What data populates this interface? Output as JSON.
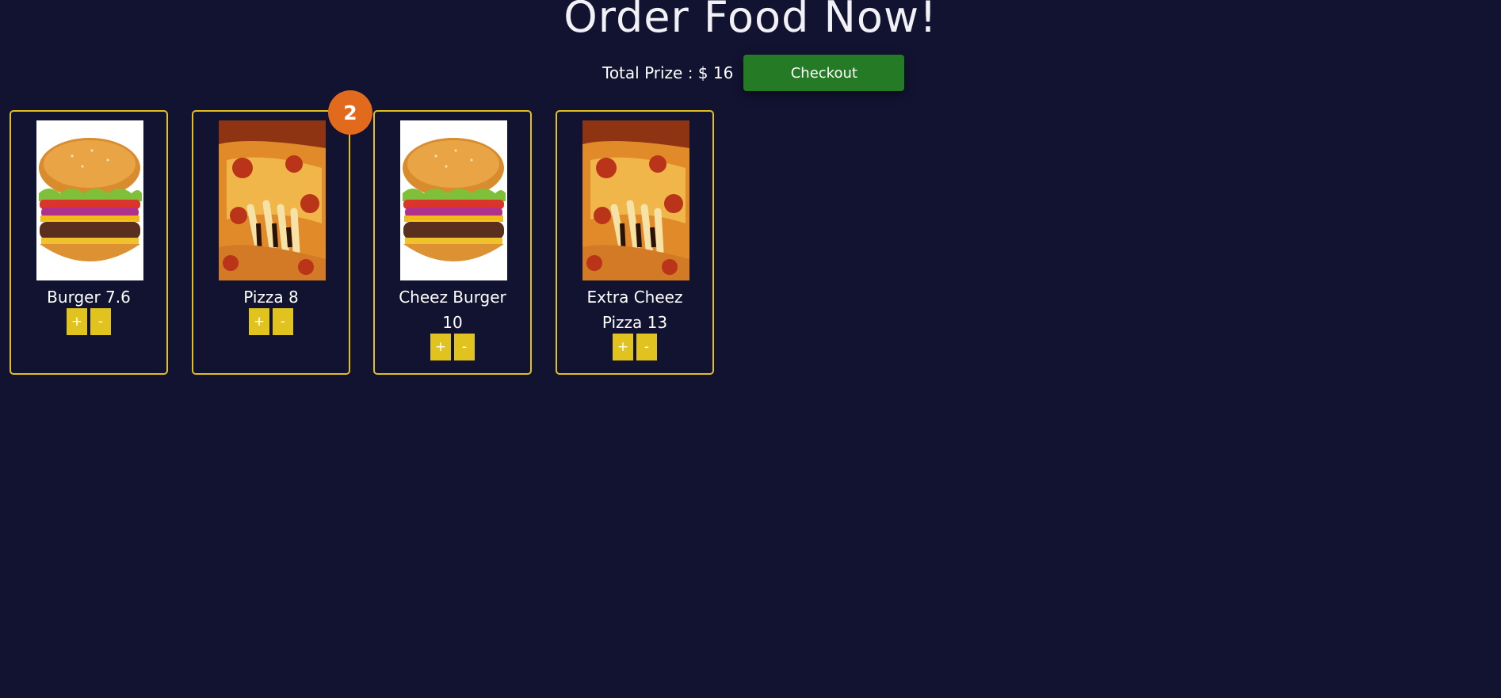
{
  "header": {
    "title": "Order Food Now!",
    "total_label": "Total Prize : $ 16",
    "checkout_label": "Checkout"
  },
  "cart": {
    "badge_count": "2"
  },
  "items": [
    {
      "label": "Burger 7.6",
      "image": "burger",
      "plus": "+",
      "minus": "-"
    },
    {
      "label": "Pizza 8",
      "image": "pizza",
      "plus": "+",
      "minus": "-"
    },
    {
      "label": "Cheez Burger 10",
      "image": "burger",
      "plus": "+",
      "minus": "-"
    },
    {
      "label": "Extra Cheez Pizza 13",
      "image": "pizza",
      "plus": "+",
      "minus": "-"
    }
  ],
  "colors": {
    "background": "#121331",
    "card_border": "#e4bf22",
    "qty_button": "#e1c31f",
    "checkout": "#257a26",
    "badge": "#e26a1c"
  }
}
